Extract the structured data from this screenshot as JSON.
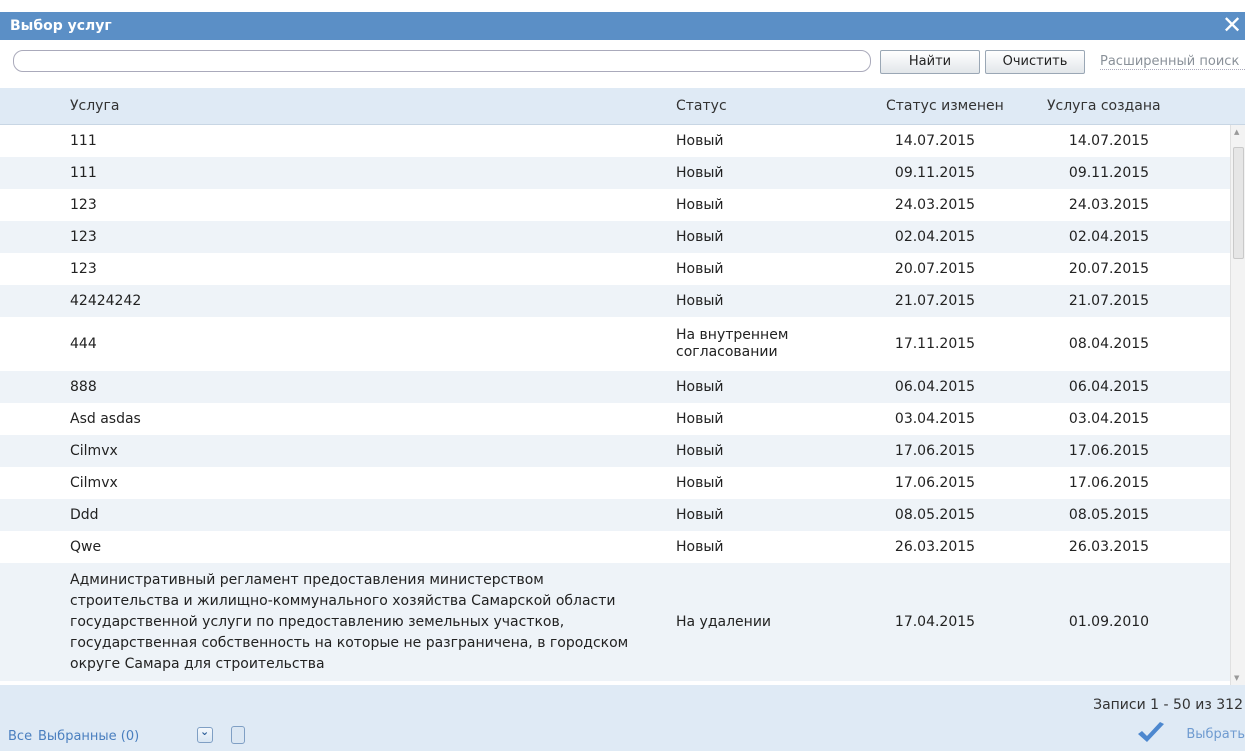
{
  "window": {
    "title": "Выбор услуг",
    "close_icon": "close-icon"
  },
  "toolbar": {
    "search_value": "",
    "find_label": "Найти",
    "clear_label": "Очистить",
    "advanced_label": "Расширенный поиск"
  },
  "table": {
    "headers": {
      "name": "Услуга",
      "status": "Статус",
      "changed": "Статус изменен",
      "created": "Услуга создана"
    },
    "rows": [
      {
        "name": "111",
        "status": "Новый",
        "changed": "14.07.2015",
        "created": "14.07.2015"
      },
      {
        "name": "111",
        "status": "Новый",
        "changed": "09.11.2015",
        "created": "09.11.2015"
      },
      {
        "name": "123",
        "status": "Новый",
        "changed": "24.03.2015",
        "created": "24.03.2015"
      },
      {
        "name": "123",
        "status": "Новый",
        "changed": "02.04.2015",
        "created": "02.04.2015"
      },
      {
        "name": "123",
        "status": "Новый",
        "changed": "20.07.2015",
        "created": "20.07.2015"
      },
      {
        "name": "42424242",
        "status": "Новый",
        "changed": "21.07.2015",
        "created": "21.07.2015"
      },
      {
        "name": "444",
        "status": "На внутреннем согласовании",
        "changed": "17.11.2015",
        "created": "08.04.2015"
      },
      {
        "name": "888",
        "status": "Новый",
        "changed": "06.04.2015",
        "created": "06.04.2015"
      },
      {
        "name": "Asd asdas",
        "status": "Новый",
        "changed": "03.04.2015",
        "created": "03.04.2015"
      },
      {
        "name": "Cilmvx",
        "status": "Новый",
        "changed": "17.06.2015",
        "created": "17.06.2015"
      },
      {
        "name": "Cilmvx",
        "status": "Новый",
        "changed": "17.06.2015",
        "created": "17.06.2015"
      },
      {
        "name": "Ddd",
        "status": "Новый",
        "changed": "08.05.2015",
        "created": "08.05.2015"
      },
      {
        "name": "Qwe",
        "status": "Новый",
        "changed": "26.03.2015",
        "created": "26.03.2015"
      },
      {
        "name": "Административный регламент предоставления министерством строительства и жилищно-коммунального хозяйства Самарской области государственной услуги по предоставлению земельных участков, государственная собственность на которые не разграничена, в городском округе Самара для строительства",
        "status": "На удалении",
        "changed": "17.04.2015",
        "created": "01.09.2010"
      }
    ]
  },
  "footer": {
    "records_text": "Записи 1 - 50 из 312",
    "all_label": "Все",
    "selected_label": "Выбранные (0)",
    "select_label": "Выбрать"
  }
}
